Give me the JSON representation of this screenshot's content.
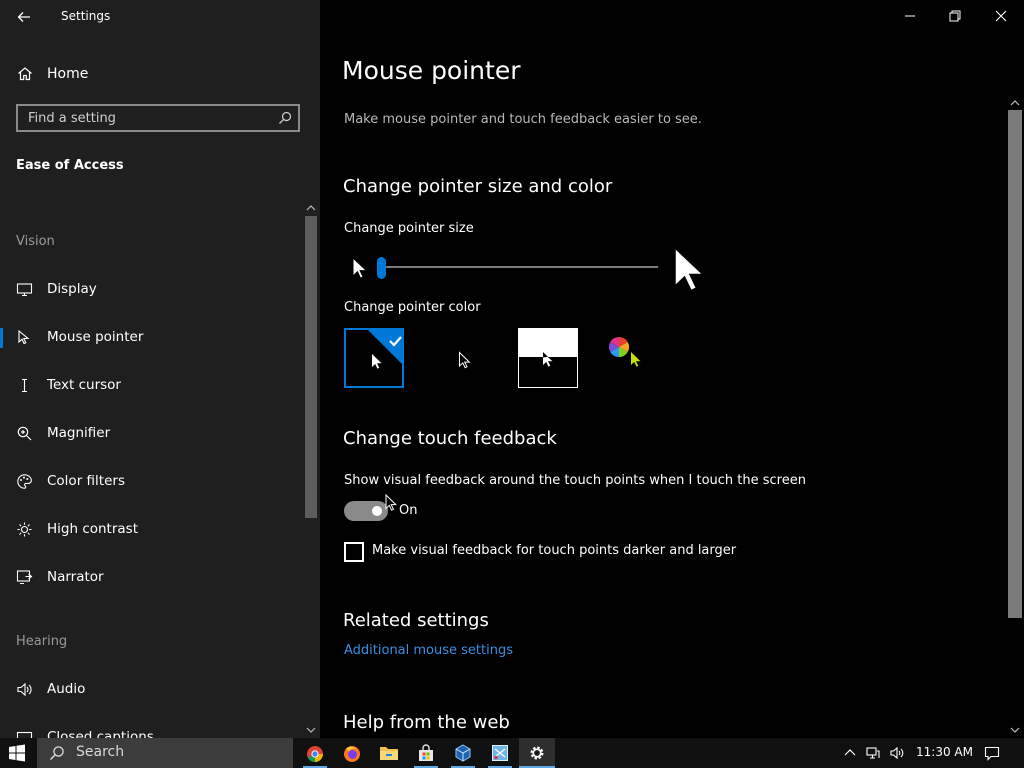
{
  "window": {
    "title": "Settings"
  },
  "sidebar": {
    "home_label": "Home",
    "search_placeholder": "Find a setting",
    "section_title": "Ease of Access",
    "groups": [
      {
        "title": "Vision"
      },
      {
        "title": "Hearing"
      }
    ],
    "vision_items": [
      {
        "label": "Display",
        "icon": "display-icon"
      },
      {
        "label": "Mouse pointer",
        "icon": "mouse-pointer-icon",
        "active": true
      },
      {
        "label": "Text cursor",
        "icon": "text-cursor-icon"
      },
      {
        "label": "Magnifier",
        "icon": "magnifier-icon"
      },
      {
        "label": "Color filters",
        "icon": "color-filters-icon"
      },
      {
        "label": "High contrast",
        "icon": "high-contrast-icon"
      },
      {
        "label": "Narrator",
        "icon": "narrator-icon"
      }
    ],
    "hearing_items": [
      {
        "label": "Audio",
        "icon": "speaker-icon"
      },
      {
        "label": "Closed captions",
        "icon": "closed-captions-icon"
      }
    ]
  },
  "main": {
    "title": "Mouse pointer",
    "description": "Make mouse pointer and touch feedback easier to see.",
    "pointer_section": {
      "heading": "Change pointer size and color",
      "size_label": "Change pointer size",
      "size_value": 1,
      "size_max": 15,
      "color_label": "Change pointer color",
      "color_options": [
        "white",
        "black",
        "inverted",
        "custom"
      ],
      "selected_color": "white"
    },
    "touch_section": {
      "heading": "Change touch feedback",
      "feedback_label": "Show visual feedback around the touch points when I touch the screen",
      "toggle_state": "On",
      "darker_label": "Make visual feedback for touch points darker and larger",
      "darker_checked": false
    },
    "related": {
      "heading": "Related settings",
      "link": "Additional mouse settings"
    },
    "help": {
      "heading": "Help from the web"
    }
  },
  "taskbar": {
    "search_placeholder": "Search",
    "apps": [
      {
        "name": "chrome-icon"
      },
      {
        "name": "firefox-icon"
      },
      {
        "name": "file-explorer-icon"
      },
      {
        "name": "store-icon"
      },
      {
        "name": "virtualbox-icon"
      },
      {
        "name": "snipping-tool-icon"
      },
      {
        "name": "settings-icon",
        "active": true
      }
    ],
    "time": "11:30 AM"
  },
  "colors": {
    "accent": "#0078d7",
    "sidebar_bg": "#1f1f1f",
    "link": "#3a8fe0"
  }
}
